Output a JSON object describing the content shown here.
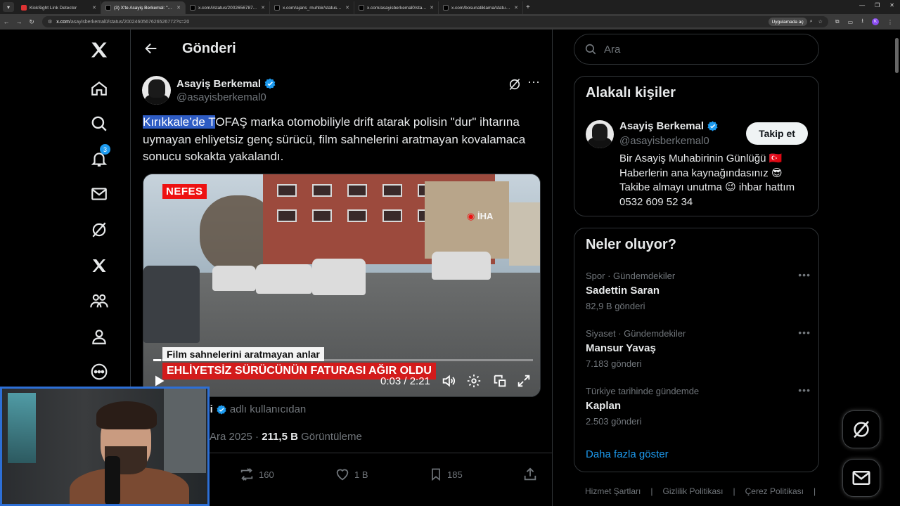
{
  "browser": {
    "tabs": [
      {
        "title": "KickSight Link Detector",
        "active": false
      },
      {
        "title": "(3) X'te Asayiş Berkemal: \"K...",
        "active": true
      },
      {
        "title": "x.com/i/status/2002656787...",
        "active": false
      },
      {
        "title": "x.com/ajans_muhbir/status/20...",
        "active": false
      },
      {
        "title": "x.com/asayisberkemal0/status/...",
        "active": false
      },
      {
        "title": "x.com/bosunatiklama/status/2...",
        "active": false
      }
    ],
    "url_host": "x.com",
    "url_path": "/asayisberkemal0/status/2002460567626526772?s=20",
    "app_pill": "Uygulamada aç",
    "profile_initial": "K"
  },
  "sidebar": {
    "notification_count": "3"
  },
  "header": {
    "title": "Gönderi"
  },
  "tweet": {
    "author_name": "Asayiş Berkemal",
    "author_handle": "@asayisberkemal0",
    "text_selected": "Kırıkkale’de T",
    "text_rest": "OFAŞ marka otomobiliyle drift atarak polisin \"dur\" ihtarına uymayan ehliyetsiz genç sürücü, film sahnelerini aratmayan kovalamaca sonucu sokakta yakalandı.",
    "video": {
      "brand": "NEFES",
      "agency": "İHA",
      "caption_top": "Film sahnelerini aratmayan anlar",
      "caption_bottom": "EHLİYETSİZ SÜRÜCÜNÜN FATURASI AĞIR OLDU",
      "time": "0:03 / 2:21",
      "progress": 0.02
    },
    "attribution_partial": "esi",
    "attribution_suffix": "adlı kullanıcıdan",
    "date_partial": "Ara 2025",
    "views": "211,5 B",
    "views_label": "Görüntüleme",
    "reposts": "160",
    "likes": "1 B",
    "bookmarks": "185"
  },
  "search": {
    "placeholder": "Ara"
  },
  "related": {
    "title": "Alakalı kişiler",
    "name": "Asayiş Berkemal",
    "handle": "@asayisberkemal0",
    "follow_label": "Takip et",
    "bio_lines": [
      "Bir Asayiş Muhabirinin Günlüğü 🇹🇷",
      "Haberlerin ana kaynağındasınız 😎",
      "Takibe almayı unutma 😉 ihbar hattım",
      "0532 609 52 34"
    ]
  },
  "trends": {
    "title": "Neler oluyor?",
    "items": [
      {
        "context": "Spor · Gündemdekiler",
        "topic": "Sadettin Saran",
        "count": "82,9 B gönderi"
      },
      {
        "context": "Siyaset · Gündemdekiler",
        "topic": "Mansur Yavaş",
        "count": "7.183 gönderi"
      },
      {
        "context": "Türkiye tarihinde gündemde",
        "topic": "Kaplan",
        "count": "2.503 gönderi"
      }
    ],
    "show_more": "Daha fazla göster"
  },
  "footer": {
    "links": [
      "Hizmet Şartları",
      "Gizlilik Politikası",
      "Çerez Politikası"
    ]
  },
  "colors": {
    "accent": "#1d9bf0",
    "background": "#000000",
    "border": "#2f3336",
    "muted": "#71767b",
    "webcam_border": "#2d6fd6"
  }
}
